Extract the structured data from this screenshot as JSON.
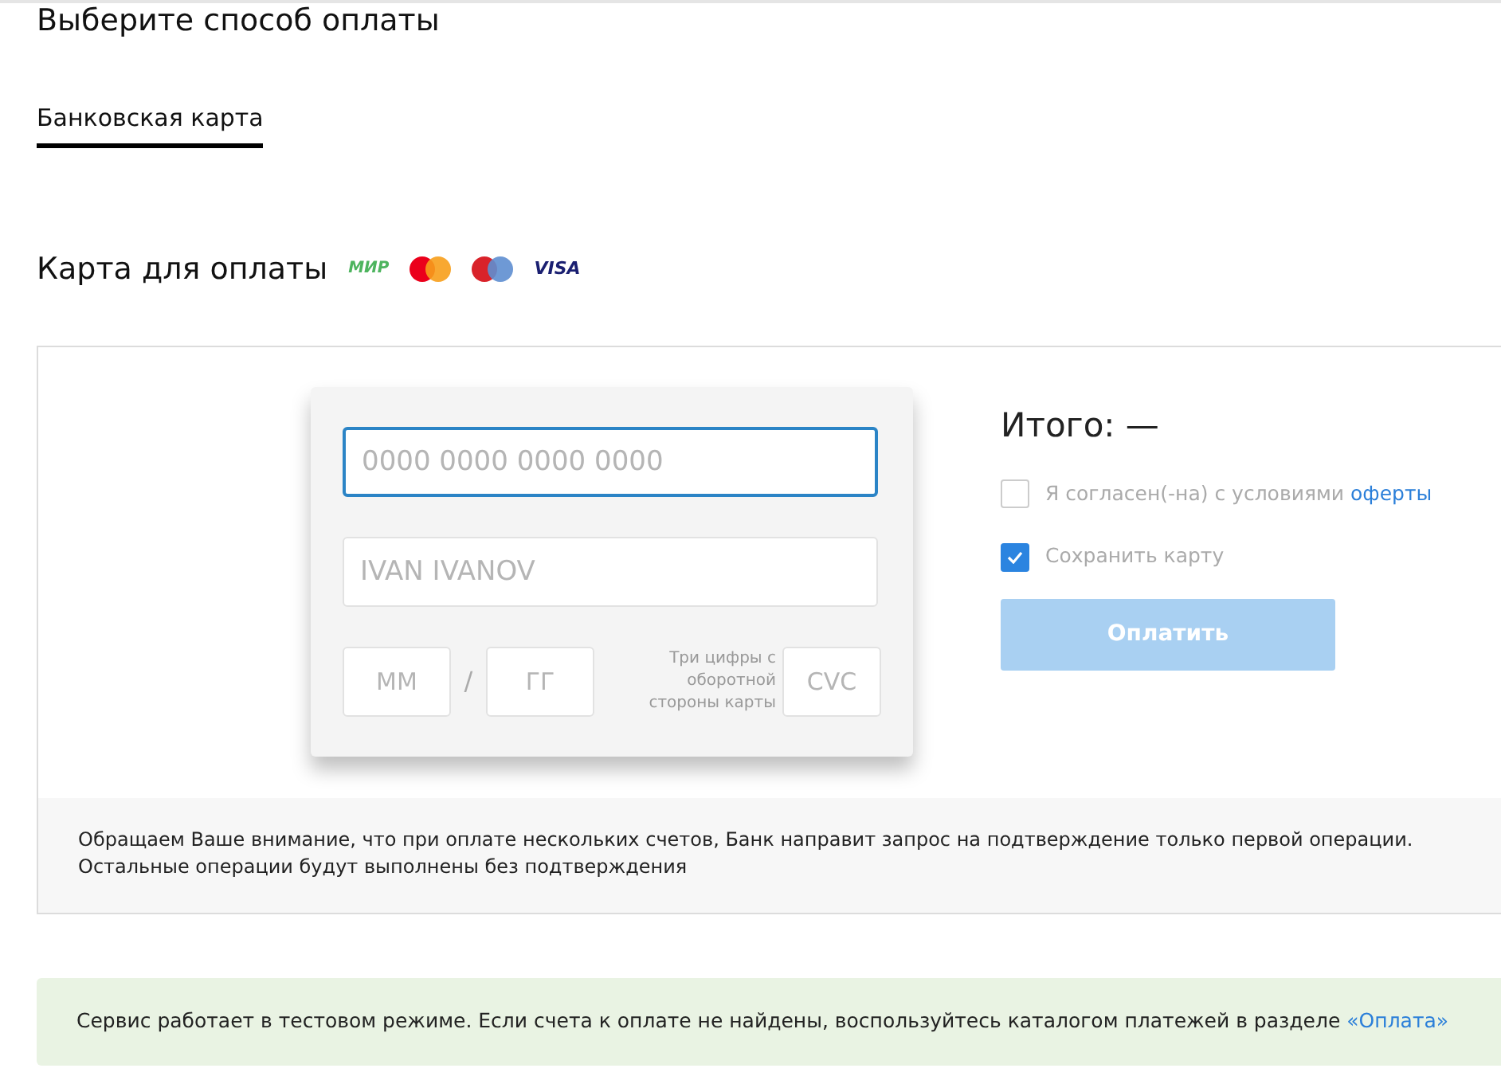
{
  "title": "Выберите способ оплаты",
  "tabs": [
    {
      "label": "Банковская карта",
      "selected": true
    }
  ],
  "card_section": {
    "title": "Карта для оплаты",
    "logos": [
      {
        "kind": "mir",
        "text": "МИР"
      },
      {
        "kind": "mastercard"
      },
      {
        "kind": "maestro"
      },
      {
        "kind": "visa",
        "text": "VISA"
      }
    ]
  },
  "form": {
    "card_number": {
      "placeholder": "0000 0000 0000 0000",
      "focused": true
    },
    "holder": {
      "placeholder": "IVAN IVANOV",
      "focused": false
    },
    "month": {
      "placeholder": "ММ"
    },
    "separator": "/",
    "year": {
      "placeholder": "ГГ"
    },
    "cvc_hint": "Три цифры с оборотной стороны карты",
    "cvc": {
      "placeholder": "CVC"
    }
  },
  "summary": {
    "total": "Итого: —",
    "checkboxes": [
      {
        "label": "Я согласен(-на) с условиями ",
        "link": "оферты",
        "checked": false
      },
      {
        "label": "Сохранить карту",
        "checked": true
      }
    ],
    "pay_button": {
      "label": "Оплатить",
      "disabled": true
    }
  },
  "notice": "Обращаем Ваше внимание, что при оплате нескольких счетов, Банк направит запрос на подтверждение только первой операции. Остальные операции будут выполнены без подтверждения",
  "info": {
    "text": "Сервис работает в тестовом режиме. Если счета к оплате не найдены, воспользуйтесь каталогом платежей в разделе ",
    "link": "«Оплата»"
  }
}
